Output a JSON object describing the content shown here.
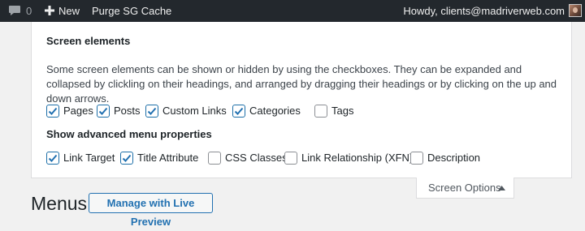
{
  "admin_bar": {
    "comments_count": "0",
    "new_label": "New",
    "purge_label": "Purge SG Cache",
    "howdy_label": "Howdy, clients@madriverweb.com"
  },
  "screen_options": {
    "title": "Screen elements",
    "description": "Some screen elements can be shown or hidden by using the checkboxes. They can be expanded and collapsed by clickling on their headings, and arranged by dragging their headings or by clicking on the up and down arrows.",
    "elements": [
      {
        "label": "Pages",
        "checked": true
      },
      {
        "label": "Posts",
        "checked": true
      },
      {
        "label": "Custom Links",
        "checked": true
      },
      {
        "label": "Categories",
        "checked": true
      },
      {
        "label": "Tags",
        "checked": false
      }
    ],
    "advanced_title": "Show advanced menu properties",
    "advanced": [
      {
        "label": "Link Target",
        "checked": true
      },
      {
        "label": "Title Attribute",
        "checked": true
      },
      {
        "label": "CSS Classes",
        "checked": false
      },
      {
        "label": "Link Relationship (XFN)",
        "checked": false
      },
      {
        "label": "Description",
        "checked": false
      }
    ],
    "tab_label": "Screen Options"
  },
  "page": {
    "title": "Menus",
    "live_preview_label": "Manage with Live Preview"
  },
  "colors": {
    "admin_bar_bg": "#23282d",
    "accent": "#2271b1",
    "checkmark": "#2271b1"
  },
  "icons": {
    "comments": "speech-bubble-icon",
    "new": "plus-icon",
    "tab_toggle": "arrow-up-icon"
  }
}
